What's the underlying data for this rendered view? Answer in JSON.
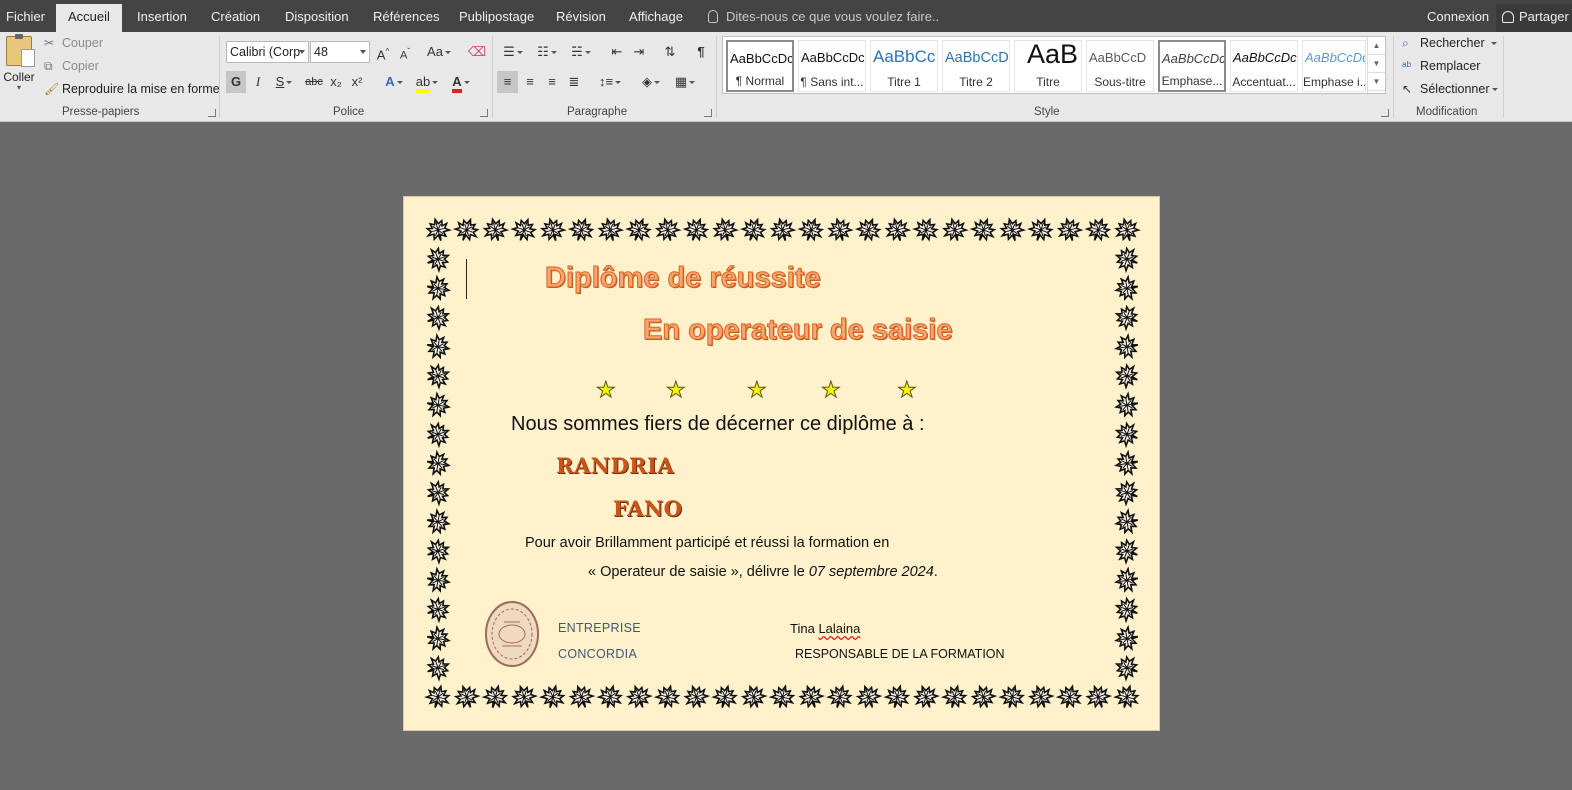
{
  "menu": {
    "tabs": [
      "Fichier",
      "Accueil",
      "Insertion",
      "Création",
      "Disposition",
      "Références",
      "Publipostage",
      "Révision",
      "Affichage"
    ],
    "active_tab": "Accueil",
    "tell_me": "Dites-nous ce que vous voulez faire..",
    "sign_in": "Connexion",
    "share": "Partager"
  },
  "ribbon": {
    "clipboard": {
      "label": "Presse-papiers",
      "paste": "Coller",
      "cut": "Couper",
      "copy": "Copier",
      "format_painter": "Reproduire la mise en forme"
    },
    "font": {
      "label": "Police",
      "font_name": "Calibri (Corp",
      "font_size": "48",
      "bold": "G",
      "italic": "I",
      "underline": "S",
      "strikethrough": "abc",
      "subscript": "x₂",
      "superscript": "x²",
      "grow": "A",
      "shrink": "A",
      "case": "Aa",
      "highlight_color": "#ffff00",
      "font_color": "#e02020"
    },
    "paragraph": {
      "label": "Paragraphe"
    },
    "styles": {
      "label": "Style",
      "items": [
        {
          "sample": "AaBbCcDc",
          "name": "¶ Normal",
          "color": "#111111"
        },
        {
          "sample": "AaBbCcDc",
          "name": "¶ Sans int...",
          "color": "#111111"
        },
        {
          "sample": "AaBbCc",
          "name": "Titre 1",
          "color": "#2e74b5"
        },
        {
          "sample": "AaBbCcD",
          "name": "Titre 2",
          "color": "#2e74b5"
        },
        {
          "sample": "AaB",
          "name": "Titre",
          "color": "#111111"
        },
        {
          "sample": "AaBbCcD",
          "name": "Sous-titre",
          "color": "#5a5a5a"
        },
        {
          "sample": "AaBbCcDc",
          "name": "Emphase...",
          "color": "#404040"
        },
        {
          "sample": "AaBbCcDc",
          "name": "Accentuat...",
          "color": "#111111"
        },
        {
          "sample": "AaBbCcDc",
          "name": "Emphase i...",
          "color": "#5b9bd5"
        }
      ]
    },
    "editing": {
      "label": "Modification",
      "find": "Rechercher",
      "replace": "Remplacer",
      "select": "Sélectionner"
    }
  },
  "document": {
    "title_line1": "Diplôme de réussite",
    "title_line2": "En operateur de saisie",
    "lead": "Nous sommes fiers de décerner ce diplôme à :",
    "name_first": "RANDRIA",
    "name_second": "FANO",
    "body_line1": "Pour avoir Brillamment participé et réussi la formation en",
    "body_line2_prefix": "« Operateur de saisie », délivre le ",
    "body_line2_date": "07 septembre 2024",
    "body_line2_suffix": ".",
    "org_line1": "ENTREPRISE",
    "org_line2": "CONCORDIA",
    "signer_first": "Tina",
    "signer_last": "Lalaina",
    "signer_role": "RESPONSABLE DE LA FORMATION",
    "stars": 5,
    "title_color": "#f6a574",
    "name_color": "#c8561a",
    "page_color": "#fff1cb"
  }
}
